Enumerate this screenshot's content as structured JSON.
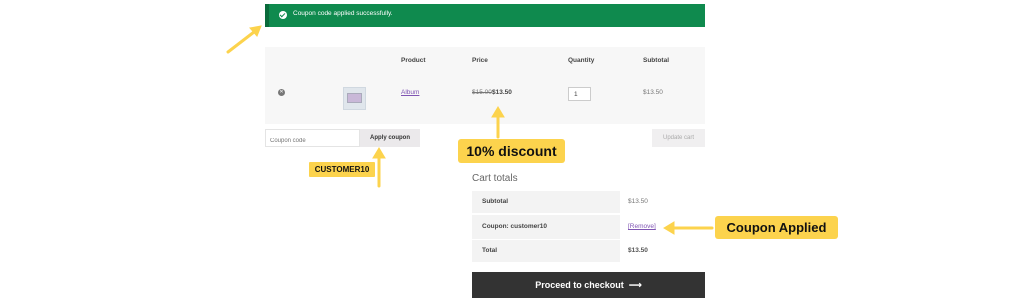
{
  "notice": {
    "icon": "check-circle-icon",
    "text": "Coupon code applied successfully.",
    "color": "#0f8a4e"
  },
  "table": {
    "headers": {
      "product": "Product",
      "price": "Price",
      "quantity": "Quantity",
      "subtotal": "Subtotal"
    },
    "row": {
      "remove_icon": "close-circle-icon",
      "product": "Album",
      "price_old": "$15.00",
      "price_new": "$13.50",
      "quantity": "1",
      "subtotal": "$13.50"
    }
  },
  "coupon": {
    "placeholder": "Coupon code",
    "apply_label": "Apply coupon",
    "update_label": "Update cart"
  },
  "totals": {
    "title": "Cart totals",
    "rows": [
      {
        "label": "Subtotal",
        "value": "$13.50"
      },
      {
        "label": "Coupon: customer10",
        "value": "[Remove]"
      },
      {
        "label": "Total",
        "value": "$13.50"
      }
    ],
    "checkout_label": "Proceed to checkout",
    "checkout_icon": "arrow-right-icon"
  },
  "callouts": {
    "discount": "10% discount",
    "code": "CUSTOMER10",
    "applied": "Coupon Applied",
    "color": "#fcd34d"
  }
}
